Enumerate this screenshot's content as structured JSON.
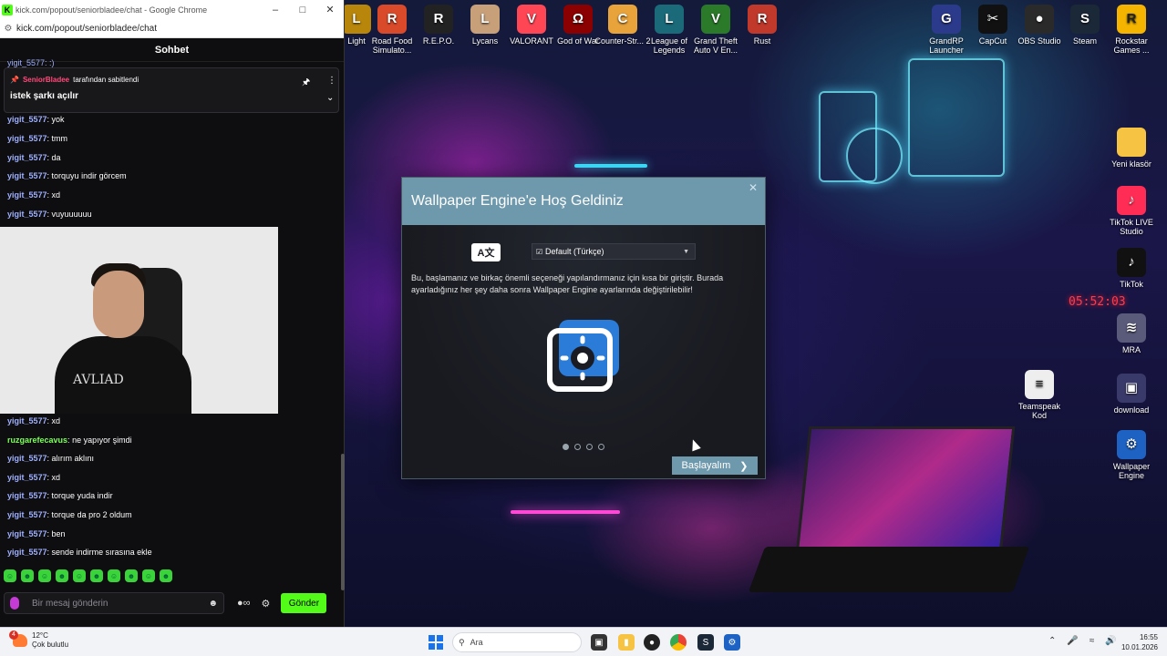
{
  "browser": {
    "window_title": "kick.com/popout/seniorbladee/chat - Google Chrome",
    "url": "kick.com/popout/seniorbladee/chat",
    "favicon_letter": "K"
  },
  "chat": {
    "header": "Sohbet",
    "top_cut_text": "yigit_5577: :)",
    "pinned": {
      "author": "SeniorBladee",
      "pinned_by_suffix": "tarafından sabitlendi",
      "message": "istek şarkı açılır"
    },
    "messages_top": [
      {
        "user": "yigit_5577",
        "text": "yok",
        "color": "#9fb0ff"
      },
      {
        "user": "yigit_5577",
        "text": "tmm",
        "color": "#9fb0ff"
      },
      {
        "user": "yigit_5577",
        "text": "da",
        "color": "#9fb0ff"
      },
      {
        "user": "yigit_5577",
        "text": "torquyu indir görcem",
        "color": "#9fb0ff"
      },
      {
        "user": "yigit_5577",
        "text": "xd",
        "color": "#9fb0ff"
      },
      {
        "user": "yigit_5577",
        "text": "vuyuuuuuu",
        "color": "#9fb0ff"
      }
    ],
    "messages_bottom": [
      {
        "user": "yigit_5577",
        "text": "xd",
        "color": "#9fb0ff"
      },
      {
        "user": "ruzgarefecavus",
        "text": "ne yapıyor şimdi",
        "color": "#7cff5a"
      },
      {
        "user": "yigit_5577",
        "text": "alırım aklını",
        "color": "#9fb0ff"
      },
      {
        "user": "yigit_5577",
        "text": "xd",
        "color": "#9fb0ff"
      },
      {
        "user": "yigit_5577",
        "text": "torque yuda indir",
        "color": "#9fb0ff"
      },
      {
        "user": "yigit_5577",
        "text": "torque da pro 2 oldum",
        "color": "#9fb0ff"
      },
      {
        "user": "yigit_5577",
        "text": "ben",
        "color": "#9fb0ff"
      },
      {
        "user": "yigit_5577",
        "text": "sende indirme sırasına ekle",
        "color": "#9fb0ff"
      }
    ],
    "webcam_shirt_text": "AVLIAD",
    "input_placeholder": "Bir mesaj gönderin",
    "send_label": "Gönder"
  },
  "desktop_icons_top": [
    {
      "label": "Light",
      "icon": "game-icon",
      "color": "#b8860b",
      "glyph": "L"
    },
    {
      "label": "Road Food Simulato...",
      "icon": "game-icon",
      "color": "#d94a2a",
      "glyph": "R"
    },
    {
      "label": "R.E.P.O.",
      "icon": "game-icon",
      "color": "#222222",
      "glyph": "R"
    },
    {
      "label": "Lycans",
      "icon": "game-icon",
      "color": "#c7a07a",
      "glyph": "L"
    },
    {
      "label": "VALORANT",
      "icon": "valorant-icon",
      "color": "#ff4655",
      "glyph": "V"
    },
    {
      "label": "God of War",
      "icon": "game-icon",
      "color": "#8b0000",
      "glyph": "Ω"
    },
    {
      "label": "Counter-Str... 2",
      "icon": "cs2-icon",
      "color": "#e8a33a",
      "glyph": "C"
    },
    {
      "label": "League of Legends",
      "icon": "lol-icon",
      "color": "#1b6a7a",
      "glyph": "L"
    },
    {
      "label": "Grand Theft Auto V En...",
      "icon": "gta-icon",
      "color": "#2a7a2a",
      "glyph": "V"
    },
    {
      "label": "Rust",
      "icon": "rust-icon",
      "color": "#c0392b",
      "glyph": "R"
    },
    {
      "label": "GrandRP Launcher",
      "icon": "launcher-icon",
      "color": "#2b3a8a",
      "glyph": "G"
    },
    {
      "label": "CapCut",
      "icon": "capcut-icon",
      "color": "#111111",
      "glyph": "✂"
    },
    {
      "label": "OBS Studio",
      "icon": "obs-icon",
      "color": "#2a2a2a",
      "glyph": "●"
    },
    {
      "label": "Steam",
      "icon": "steam-icon",
      "color": "#1b2838",
      "glyph": "S"
    },
    {
      "label": "Rockstar Games ...",
      "icon": "rockstar-icon",
      "color": "#f4b400",
      "glyph": "R"
    }
  ],
  "desktop_icons_right": [
    {
      "label": "Yeni klasör",
      "icon": "folder-icon",
      "color": "#f6c343",
      "glyph": ""
    },
    {
      "label": "TikTok LIVE Studio",
      "icon": "tiktok-live-icon",
      "color": "#ff2d55",
      "glyph": "♪"
    },
    {
      "label": "TikTok",
      "icon": "tiktok-icon",
      "color": "#111111",
      "glyph": "♪"
    },
    {
      "label": "MRA",
      "icon": "audio-icon",
      "color": "#5a5a7a",
      "glyph": "≋"
    },
    {
      "label": "Teamspeak Kod",
      "icon": "text-file-icon",
      "color": "#eeeeee",
      "glyph": "≡"
    },
    {
      "label": "download",
      "icon": "image-icon",
      "color": "#3a3a6a",
      "glyph": "▣"
    },
    {
      "label": "Wallpaper Engine",
      "icon": "wallpaper-engine-icon",
      "color": "#1e63c4",
      "glyph": "⚙"
    }
  ],
  "wallpaper_clock": "05:52:03",
  "we_dialog": {
    "title": "Wallpaper Engine'e Hoş Geldiniz",
    "language_value": "Default (Türkçe)",
    "description": "Bu, başlamanız ve birkaç önemli seçeneği yapılandırmanız için kısa bir giriştir. Burada ayarladığınız her şey daha sonra Wallpaper Engine ayarlarında değiştirilebilir!",
    "start_label": "Başlayalım",
    "step_current": 1,
    "step_total": 4,
    "accent": "#6e98ac"
  },
  "taskbar": {
    "weather_temp": "12°C",
    "weather_desc": "Çok bulutlu",
    "weather_badge": "4",
    "search_placeholder": "Ara",
    "time": "16:55",
    "date": "10.01.2026"
  }
}
